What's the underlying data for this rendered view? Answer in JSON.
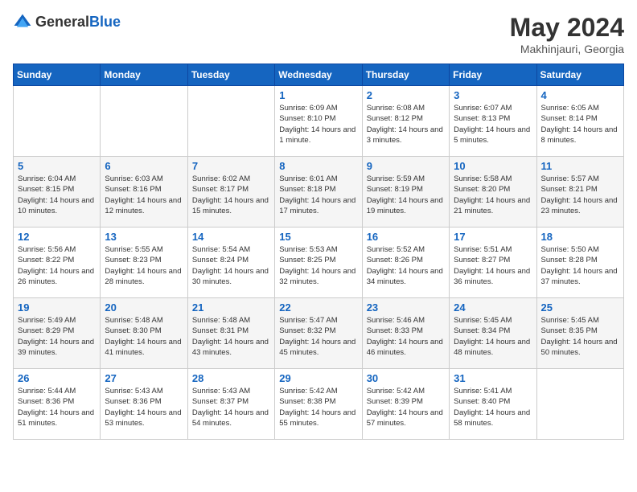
{
  "header": {
    "logo_general": "General",
    "logo_blue": "Blue",
    "title": "May 2024",
    "location": "Makhinjauri, Georgia"
  },
  "days_of_week": [
    "Sunday",
    "Monday",
    "Tuesday",
    "Wednesday",
    "Thursday",
    "Friday",
    "Saturday"
  ],
  "weeks": [
    [
      {
        "day": "",
        "sunrise": "",
        "sunset": "",
        "daylight": ""
      },
      {
        "day": "",
        "sunrise": "",
        "sunset": "",
        "daylight": ""
      },
      {
        "day": "",
        "sunrise": "",
        "sunset": "",
        "daylight": ""
      },
      {
        "day": "1",
        "sunrise": "Sunrise: 6:09 AM",
        "sunset": "Sunset: 8:10 PM",
        "daylight": "Daylight: 14 hours and 1 minute."
      },
      {
        "day": "2",
        "sunrise": "Sunrise: 6:08 AM",
        "sunset": "Sunset: 8:12 PM",
        "daylight": "Daylight: 14 hours and 3 minutes."
      },
      {
        "day": "3",
        "sunrise": "Sunrise: 6:07 AM",
        "sunset": "Sunset: 8:13 PM",
        "daylight": "Daylight: 14 hours and 5 minutes."
      },
      {
        "day": "4",
        "sunrise": "Sunrise: 6:05 AM",
        "sunset": "Sunset: 8:14 PM",
        "daylight": "Daylight: 14 hours and 8 minutes."
      }
    ],
    [
      {
        "day": "5",
        "sunrise": "Sunrise: 6:04 AM",
        "sunset": "Sunset: 8:15 PM",
        "daylight": "Daylight: 14 hours and 10 minutes."
      },
      {
        "day": "6",
        "sunrise": "Sunrise: 6:03 AM",
        "sunset": "Sunset: 8:16 PM",
        "daylight": "Daylight: 14 hours and 12 minutes."
      },
      {
        "day": "7",
        "sunrise": "Sunrise: 6:02 AM",
        "sunset": "Sunset: 8:17 PM",
        "daylight": "Daylight: 14 hours and 15 minutes."
      },
      {
        "day": "8",
        "sunrise": "Sunrise: 6:01 AM",
        "sunset": "Sunset: 8:18 PM",
        "daylight": "Daylight: 14 hours and 17 minutes."
      },
      {
        "day": "9",
        "sunrise": "Sunrise: 5:59 AM",
        "sunset": "Sunset: 8:19 PM",
        "daylight": "Daylight: 14 hours and 19 minutes."
      },
      {
        "day": "10",
        "sunrise": "Sunrise: 5:58 AM",
        "sunset": "Sunset: 8:20 PM",
        "daylight": "Daylight: 14 hours and 21 minutes."
      },
      {
        "day": "11",
        "sunrise": "Sunrise: 5:57 AM",
        "sunset": "Sunset: 8:21 PM",
        "daylight": "Daylight: 14 hours and 23 minutes."
      }
    ],
    [
      {
        "day": "12",
        "sunrise": "Sunrise: 5:56 AM",
        "sunset": "Sunset: 8:22 PM",
        "daylight": "Daylight: 14 hours and 26 minutes."
      },
      {
        "day": "13",
        "sunrise": "Sunrise: 5:55 AM",
        "sunset": "Sunset: 8:23 PM",
        "daylight": "Daylight: 14 hours and 28 minutes."
      },
      {
        "day": "14",
        "sunrise": "Sunrise: 5:54 AM",
        "sunset": "Sunset: 8:24 PM",
        "daylight": "Daylight: 14 hours and 30 minutes."
      },
      {
        "day": "15",
        "sunrise": "Sunrise: 5:53 AM",
        "sunset": "Sunset: 8:25 PM",
        "daylight": "Daylight: 14 hours and 32 minutes."
      },
      {
        "day": "16",
        "sunrise": "Sunrise: 5:52 AM",
        "sunset": "Sunset: 8:26 PM",
        "daylight": "Daylight: 14 hours and 34 minutes."
      },
      {
        "day": "17",
        "sunrise": "Sunrise: 5:51 AM",
        "sunset": "Sunset: 8:27 PM",
        "daylight": "Daylight: 14 hours and 36 minutes."
      },
      {
        "day": "18",
        "sunrise": "Sunrise: 5:50 AM",
        "sunset": "Sunset: 8:28 PM",
        "daylight": "Daylight: 14 hours and 37 minutes."
      }
    ],
    [
      {
        "day": "19",
        "sunrise": "Sunrise: 5:49 AM",
        "sunset": "Sunset: 8:29 PM",
        "daylight": "Daylight: 14 hours and 39 minutes."
      },
      {
        "day": "20",
        "sunrise": "Sunrise: 5:48 AM",
        "sunset": "Sunset: 8:30 PM",
        "daylight": "Daylight: 14 hours and 41 minutes."
      },
      {
        "day": "21",
        "sunrise": "Sunrise: 5:48 AM",
        "sunset": "Sunset: 8:31 PM",
        "daylight": "Daylight: 14 hours and 43 minutes."
      },
      {
        "day": "22",
        "sunrise": "Sunrise: 5:47 AM",
        "sunset": "Sunset: 8:32 PM",
        "daylight": "Daylight: 14 hours and 45 minutes."
      },
      {
        "day": "23",
        "sunrise": "Sunrise: 5:46 AM",
        "sunset": "Sunset: 8:33 PM",
        "daylight": "Daylight: 14 hours and 46 minutes."
      },
      {
        "day": "24",
        "sunrise": "Sunrise: 5:45 AM",
        "sunset": "Sunset: 8:34 PM",
        "daylight": "Daylight: 14 hours and 48 minutes."
      },
      {
        "day": "25",
        "sunrise": "Sunrise: 5:45 AM",
        "sunset": "Sunset: 8:35 PM",
        "daylight": "Daylight: 14 hours and 50 minutes."
      }
    ],
    [
      {
        "day": "26",
        "sunrise": "Sunrise: 5:44 AM",
        "sunset": "Sunset: 8:36 PM",
        "daylight": "Daylight: 14 hours and 51 minutes."
      },
      {
        "day": "27",
        "sunrise": "Sunrise: 5:43 AM",
        "sunset": "Sunset: 8:36 PM",
        "daylight": "Daylight: 14 hours and 53 minutes."
      },
      {
        "day": "28",
        "sunrise": "Sunrise: 5:43 AM",
        "sunset": "Sunset: 8:37 PM",
        "daylight": "Daylight: 14 hours and 54 minutes."
      },
      {
        "day": "29",
        "sunrise": "Sunrise: 5:42 AM",
        "sunset": "Sunset: 8:38 PM",
        "daylight": "Daylight: 14 hours and 55 minutes."
      },
      {
        "day": "30",
        "sunrise": "Sunrise: 5:42 AM",
        "sunset": "Sunset: 8:39 PM",
        "daylight": "Daylight: 14 hours and 57 minutes."
      },
      {
        "day": "31",
        "sunrise": "Sunrise: 5:41 AM",
        "sunset": "Sunset: 8:40 PM",
        "daylight": "Daylight: 14 hours and 58 minutes."
      },
      {
        "day": "",
        "sunrise": "",
        "sunset": "",
        "daylight": ""
      }
    ]
  ]
}
